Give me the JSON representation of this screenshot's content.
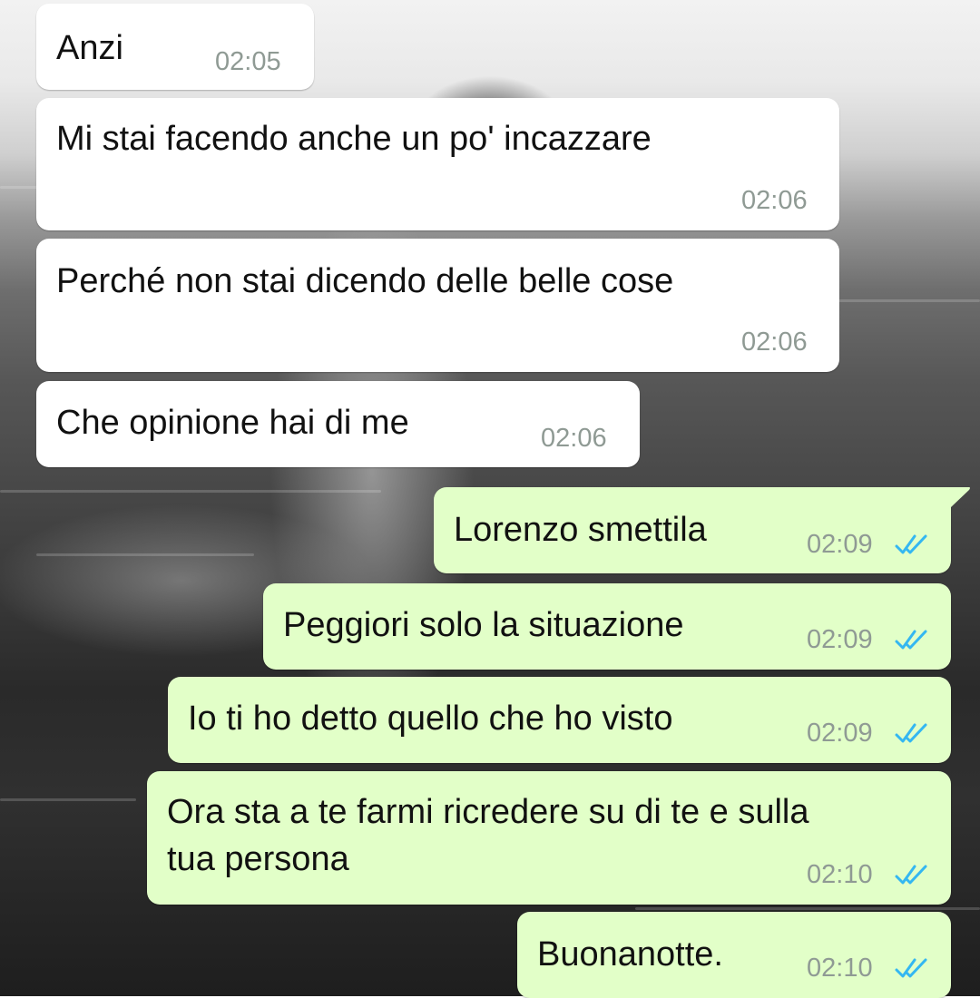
{
  "chat": {
    "received": [
      {
        "text": "Anzi",
        "time": "02:05"
      },
      {
        "text": "Mi stai facendo anche un po' incazzare",
        "time": "02:06"
      },
      {
        "text": "Perché non stai dicendo delle belle cose",
        "time": "02:06"
      },
      {
        "text": "Che opinione hai di me",
        "time": "02:06"
      }
    ],
    "sent": [
      {
        "text": "Lorenzo smettila",
        "time": "02:09",
        "status_icon": "double-check-read-icon"
      },
      {
        "text": "Peggiori solo la situazione",
        "time": "02:09",
        "status_icon": "double-check-read-icon"
      },
      {
        "text": "Io ti ho detto quello che ho visto",
        "time": "02:09",
        "status_icon": "double-check-read-icon"
      },
      {
        "text_line_1": "Ora sta a te farmi ricredere su di te e sulla",
        "text_line_2": "tua persona",
        "time": "02:10",
        "status_icon": "double-check-read-icon"
      },
      {
        "text": "Buonanotte.",
        "time": "02:10",
        "status_icon": "double-check-read-icon"
      }
    ]
  },
  "colors": {
    "incoming_bubble": "#ffffff",
    "outgoing_bubble": "#e2ffc8",
    "read_ticks": "#34b7f1",
    "timestamp": "#8f9a94"
  }
}
